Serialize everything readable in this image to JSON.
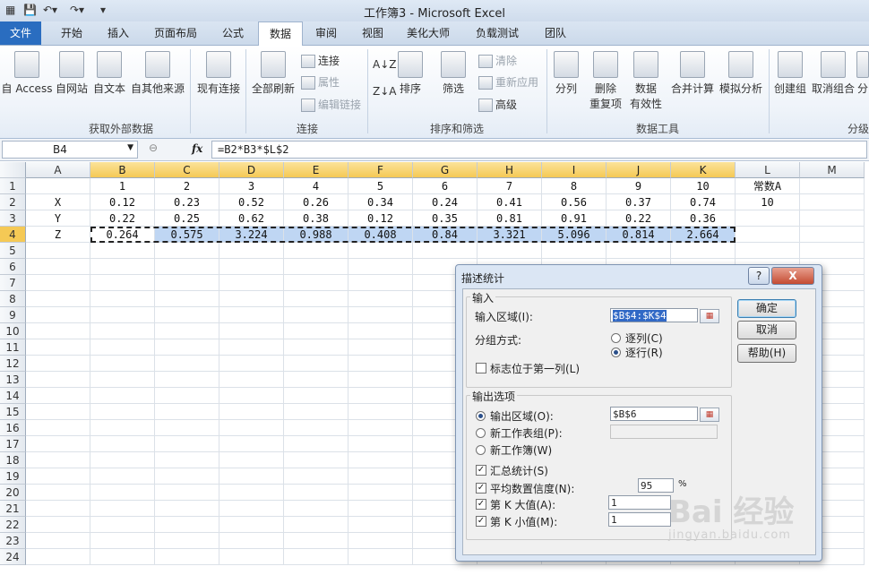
{
  "window": {
    "title": "工作簿3 - Microsoft Excel"
  },
  "tabs": [
    "文件",
    "开始",
    "插入",
    "页面布局",
    "公式",
    "数据",
    "审阅",
    "视图",
    "美化大师",
    "负载测试",
    "团队"
  ],
  "ribbon": {
    "groups": {
      "external": "获取外部数据",
      "connections": "连接",
      "sort_filter": "排序和筛选",
      "data_tools": "数据工具",
      "outline": "分级"
    },
    "buttons": {
      "access": "自 Access",
      "web": "自网站",
      "text": "自文本",
      "other": "自其他来源",
      "existing": "现有连接",
      "refresh_all": "全部刷新",
      "connections": "连接",
      "properties": "属性",
      "edit_links": "编辑链接",
      "sort_az": "A↓Z",
      "sort": "排序",
      "filter": "筛选",
      "clear": "清除",
      "reapply": "重新应用",
      "advanced": "高级",
      "split": "分列",
      "remove_dup_1": "删除",
      "remove_dup_2": "重复项",
      "validation_1": "数据",
      "validation_2": "有效性",
      "consolidate": "合并计算",
      "whatif": "模拟分析",
      "group": "创建组",
      "ungroup": "取消组合",
      "subtotal": "分"
    }
  },
  "formula_bar": {
    "name_box": "B4",
    "fx": "fx",
    "formula": "=B2*B3*$L$2"
  },
  "grid": {
    "columns": [
      "A",
      "B",
      "C",
      "D",
      "E",
      "F",
      "G",
      "H",
      "I",
      "J",
      "K",
      "L",
      "M"
    ],
    "rows": [
      "1",
      "2",
      "3",
      "4",
      "5",
      "6",
      "7",
      "8",
      "9",
      "10",
      "11",
      "12",
      "13",
      "14",
      "15",
      "16",
      "17",
      "18",
      "19",
      "20",
      "21",
      "22",
      "23",
      "24"
    ],
    "row1": [
      "",
      "1",
      "2",
      "3",
      "4",
      "5",
      "6",
      "7",
      "8",
      "9",
      "10",
      "常数A",
      ""
    ],
    "row2": [
      "X",
      "0.12",
      "0.23",
      "0.52",
      "0.26",
      "0.34",
      "0.24",
      "0.41",
      "0.56",
      "0.37",
      "0.74",
      "10",
      ""
    ],
    "row3": [
      "Y",
      "0.22",
      "0.25",
      "0.62",
      "0.38",
      "0.12",
      "0.35",
      "0.81",
      "0.91",
      "0.22",
      "0.36",
      "",
      ""
    ],
    "row4": [
      "Z",
      "0.264",
      "0.575",
      "3.224",
      "0.988",
      "0.408",
      "0.84",
      "3.321",
      "5.096",
      "0.814",
      "2.664",
      "",
      ""
    ]
  },
  "dialog": {
    "title": "描述统计",
    "help_icon": "?",
    "close_icon": "X",
    "input_section": "输入",
    "input_range_label": "输入区域(I):",
    "input_range_value": "$B$4:$K$4",
    "grouping_label": "分组方式:",
    "by_column": "逐列(C)",
    "by_row": "逐行(R)",
    "labels_first_col": "标志位于第一列(L)",
    "output_section": "输出选项",
    "output_range_label": "输出区域(O):",
    "output_range_value": "$B$6",
    "new_sheet_label": "新工作表组(P):",
    "new_workbook_label": "新工作簿(W)",
    "summary_stats": "汇总统计(S)",
    "confidence_label": "平均数置信度(N):",
    "confidence_value": "95",
    "percent": "%",
    "kth_largest_label": "第 K 大值(A):",
    "kth_largest_value": "1",
    "kth_smallest_label": "第 K 小值(M):",
    "kth_smallest_value": "1",
    "ok": "确定",
    "cancel": "取消",
    "help": "帮助(H)"
  },
  "watermark": {
    "brand": "Bai 经验",
    "url": "jingyan.baidu.com"
  }
}
